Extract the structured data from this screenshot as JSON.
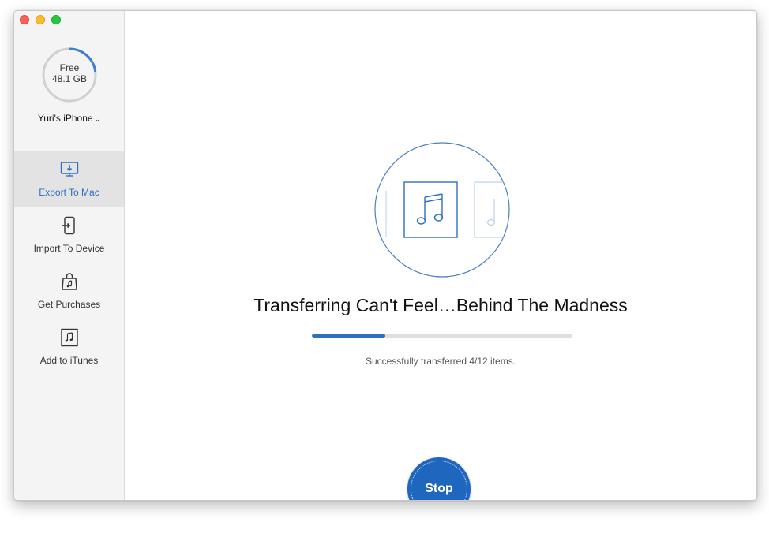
{
  "window": {
    "controls": [
      "close",
      "minimize",
      "maximize"
    ]
  },
  "sidebar": {
    "storage": {
      "free_label": "Free",
      "free_value": "48.1 GB",
      "used_fraction": 0.23,
      "ring_color": "#3f7fd0"
    },
    "device": {
      "name": "Yuri's iPhone",
      "chevron_icon": "chevron-down-icon"
    },
    "items": [
      {
        "label": "Export To Mac",
        "icon": "monitor-download-icon",
        "active": true
      },
      {
        "label": "Import To Device",
        "icon": "phone-import-icon",
        "active": false
      },
      {
        "label": "Get Purchases",
        "icon": "shopping-bag-music-icon",
        "active": false
      },
      {
        "label": "Add to iTunes",
        "icon": "music-note-file-icon",
        "active": false
      }
    ]
  },
  "main": {
    "title": "Transferring Can't Feel…Behind The Madness",
    "progress": {
      "completed": 4,
      "total": 12,
      "fraction": 0.2833
    },
    "status": "Successfully transferred 4/12 items.",
    "stop_label": "Stop",
    "accent_color": "#2f6fbf"
  }
}
